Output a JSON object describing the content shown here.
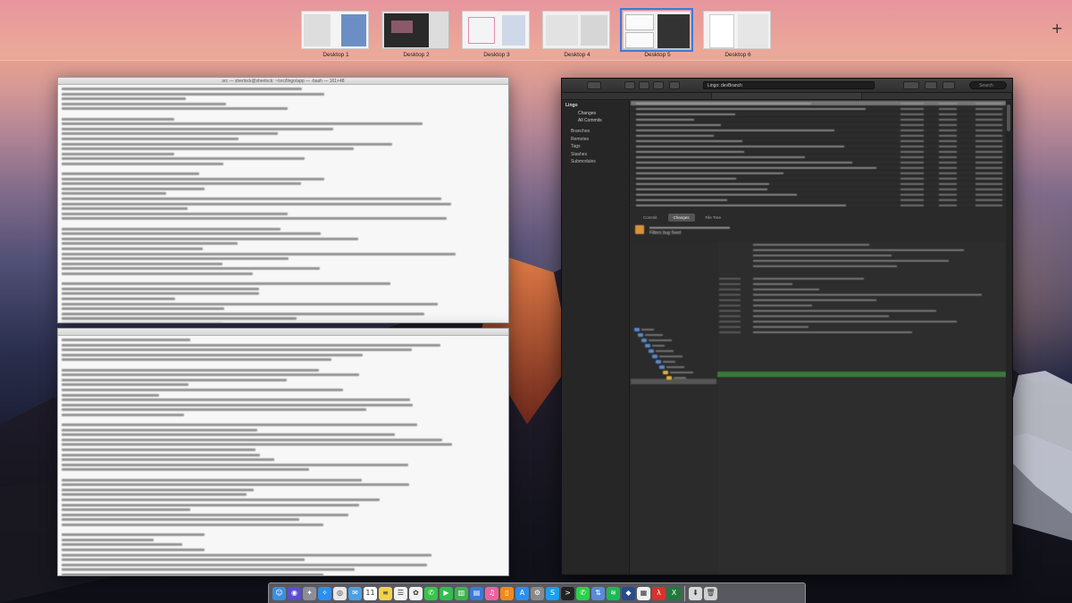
{
  "spaces": {
    "desktops": [
      {
        "label": "Desktop 1",
        "active": false
      },
      {
        "label": "Desktop 2",
        "active": false
      },
      {
        "label": "Desktop 3",
        "active": false
      },
      {
        "label": "Desktop 4",
        "active": false
      },
      {
        "label": "Desktop 5",
        "active": true
      },
      {
        "label": "Desktop 6",
        "active": false
      }
    ],
    "add_label": "+"
  },
  "terminal_top": {
    "title": "src — sherlock@sherlock: ~/src/lingo/app — -bash — 161×48"
  },
  "terminal_bottom": {
    "title": ""
  },
  "git_app": {
    "branch": "Lingo: devBranch",
    "search_placeholder": "Search",
    "repo_name": "Lingo",
    "sidebar": {
      "items": [
        "Changes",
        "All Commits"
      ],
      "sections": [
        "Branches",
        "Remotes",
        "Tags",
        "Stashes",
        "Submodules"
      ]
    },
    "detail_tabs": [
      "Commit",
      "Changes",
      "File Tree"
    ],
    "active_detail_tab": "Changes",
    "commit_subject": "Filters bug fixed"
  },
  "dock": {
    "icons": [
      {
        "name": "finder-icon",
        "bg": "#3b8fe0",
        "glyph": "☺"
      },
      {
        "name": "siri-icon",
        "bg": "#5b4fd0",
        "glyph": "◉"
      },
      {
        "name": "launchpad-icon",
        "bg": "#8e8e98",
        "glyph": "✦"
      },
      {
        "name": "safari-icon",
        "bg": "#2a8ff0",
        "glyph": "✧"
      },
      {
        "name": "chrome-icon",
        "bg": "#e8e8e8",
        "glyph": "◎"
      },
      {
        "name": "mail-icon",
        "bg": "#4aa0e8",
        "glyph": "✉"
      },
      {
        "name": "calendar-icon",
        "bg": "#ffffff",
        "glyph": "11"
      },
      {
        "name": "notes-icon",
        "bg": "#f5d24a",
        "glyph": "≡"
      },
      {
        "name": "reminders-icon",
        "bg": "#f2f2f2",
        "glyph": "☰"
      },
      {
        "name": "photos-icon",
        "bg": "#f0f0f0",
        "glyph": "✿"
      },
      {
        "name": "messages-icon",
        "bg": "#38c54a",
        "glyph": "✆"
      },
      {
        "name": "facetime-icon",
        "bg": "#2fbf4a",
        "glyph": "▶"
      },
      {
        "name": "numbers-icon",
        "bg": "#3ab54a",
        "glyph": "▥"
      },
      {
        "name": "keynote-icon",
        "bg": "#3a7ad8",
        "glyph": "▤"
      },
      {
        "name": "itunes-icon",
        "bg": "#f060a0",
        "glyph": "♫"
      },
      {
        "name": "ibooks-icon",
        "bg": "#f08a1a",
        "glyph": "▯"
      },
      {
        "name": "appstore-icon",
        "bg": "#2a8ff0",
        "glyph": "A"
      },
      {
        "name": "preferences-icon",
        "bg": "#8a8a8a",
        "glyph": "⚙"
      },
      {
        "name": "skype-icon",
        "bg": "#1aa0f0",
        "glyph": "S"
      },
      {
        "name": "terminal-icon",
        "bg": "#222222",
        "glyph": ">"
      },
      {
        "name": "whatsapp-icon",
        "bg": "#2ad14a",
        "glyph": "✆"
      },
      {
        "name": "transmit-icon",
        "bg": "#5a8ad8",
        "glyph": "⇅"
      },
      {
        "name": "spotify-icon",
        "bg": "#1db954",
        "glyph": "≋"
      },
      {
        "name": "sourcetree-icon",
        "bg": "#2a4a8a",
        "glyph": "◆"
      },
      {
        "name": "preview-icon",
        "bg": "#f0f0f0",
        "glyph": "▦"
      },
      {
        "name": "acrobat-icon",
        "bg": "#d8322a",
        "glyph": "λ"
      },
      {
        "name": "excel-icon",
        "bg": "#1f7a3a",
        "glyph": "X"
      },
      {
        "name": "downloads-icon",
        "bg": "#d8d8d8",
        "glyph": "⬇"
      },
      {
        "name": "trash-icon",
        "bg": "#cfcfcf",
        "glyph": "🗑"
      }
    ]
  }
}
